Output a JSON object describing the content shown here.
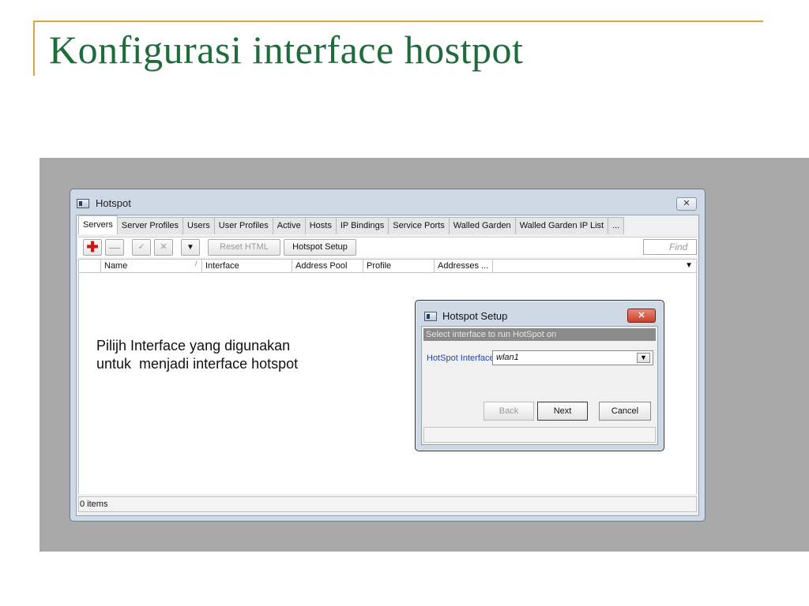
{
  "slide": {
    "title": "Konfigurasi interface hostpot",
    "accent_color": "#d9a441",
    "title_color": "#1f6b3c"
  },
  "window": {
    "title": "Hotspot",
    "close_glyph": "✕",
    "tabs": [
      "Servers",
      "Server Profiles",
      "Users",
      "User Profiles",
      "Active",
      "Hosts",
      "IP Bindings",
      "Service Ports",
      "Walled Garden",
      "Walled Garden IP List",
      "..."
    ],
    "toolbar": {
      "add_glyph": "✚",
      "remove_glyph": "—",
      "enable_glyph": "✓",
      "disable_glyph": "✕",
      "filter_glyph": "▼",
      "reset_html_label": "Reset HTML",
      "hotspot_setup_label": "Hotspot Setup",
      "find_placeholder": "Find"
    },
    "columns": [
      "Name",
      "Interface",
      "Address Pool",
      "Profile",
      "Addresses ..."
    ],
    "sort_mark": "/",
    "column_menu_glyph": "▼",
    "status": "0 items"
  },
  "annotation": {
    "text": "Pilijh Interface yang digunakan\nuntuk  menjadi interface hotspot"
  },
  "dialog": {
    "title": "Hotspot Setup",
    "close_glyph": "✕",
    "banner": "Select interface to run HotSpot on",
    "field_label": "HotSpot Interface:",
    "field_value": "wlan1",
    "dropdown_glyph": "▼",
    "buttons": {
      "back": "Back",
      "next": "Next",
      "cancel": "Cancel"
    }
  }
}
